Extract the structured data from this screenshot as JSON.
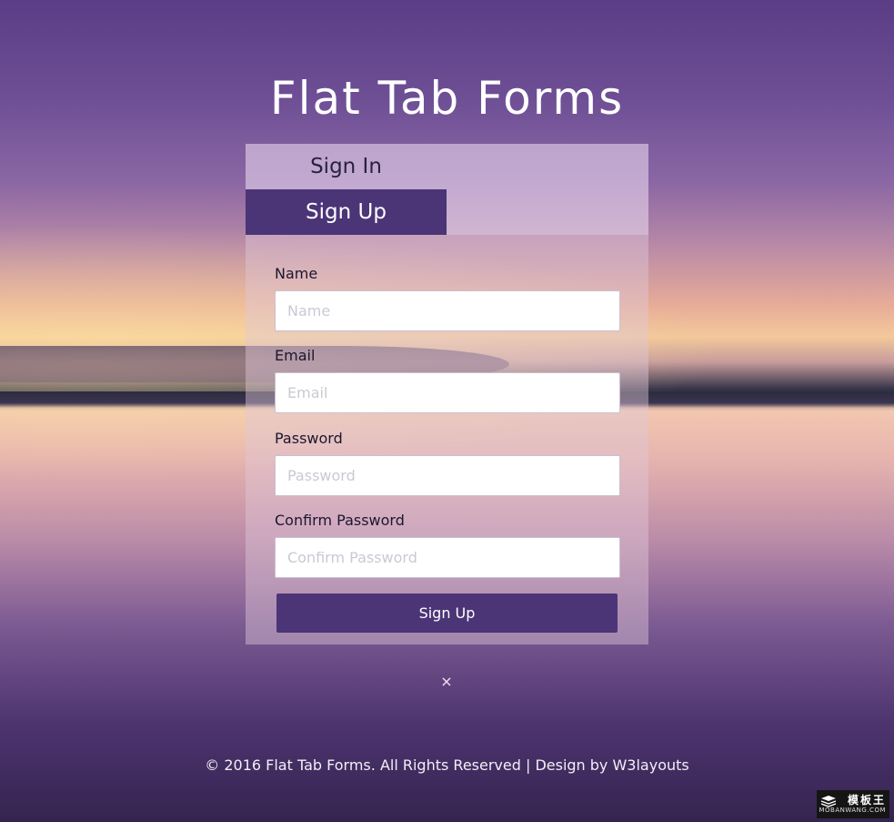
{
  "page": {
    "title": "Flat Tab Forms"
  },
  "tabs": {
    "sign_in": "Sign In",
    "sign_up": "Sign Up"
  },
  "form": {
    "fields": [
      {
        "label": "Name",
        "placeholder": "Name",
        "value": ""
      },
      {
        "label": "Email",
        "placeholder": "Email",
        "value": ""
      },
      {
        "label": "Password",
        "placeholder": "Password",
        "value": ""
      },
      {
        "label": "Confirm Password",
        "placeholder": "Confirm Password",
        "value": ""
      }
    ],
    "submit_label": "Sign Up"
  },
  "close": {
    "glyph": "×",
    "icon": "close-icon"
  },
  "footer": {
    "text": "© 2016 Flat Tab Forms. All Rights Reserved | Design by W3layouts"
  },
  "watermark": {
    "name": "模板王",
    "url": "MOBANWANG.COM"
  },
  "colors": {
    "accent": "#4b3577",
    "text_light": "#ffffff"
  }
}
